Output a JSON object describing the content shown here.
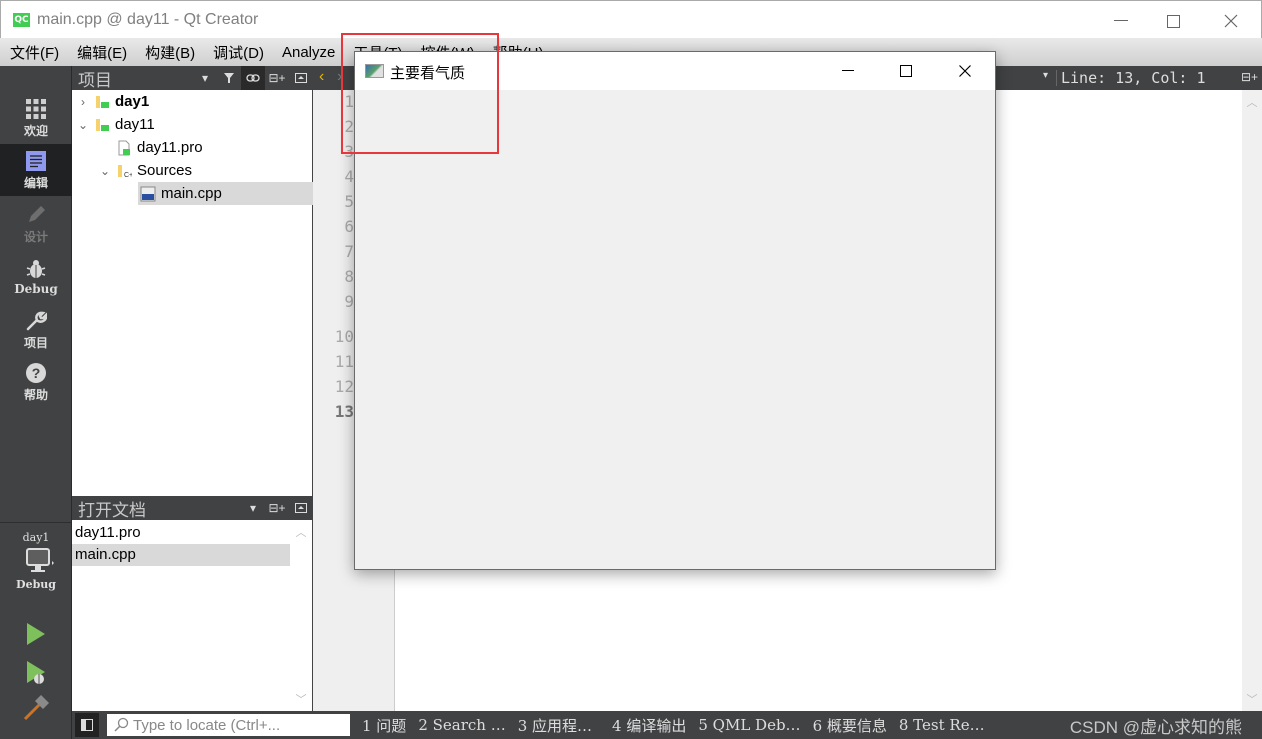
{
  "window": {
    "logo_text": "QC",
    "title": "main.cpp @ day11 - Qt Creator"
  },
  "menubar": {
    "items": [
      "文件(F)",
      "编辑(E)",
      "构建(B)",
      "调试(D)",
      "Analyze",
      "工具(T)",
      "控件(W)",
      "帮助(H)"
    ]
  },
  "modes": [
    {
      "label": "欢迎",
      "icon": "grid-icon",
      "state": "normal"
    },
    {
      "label": "编辑",
      "icon": "edit-document-icon",
      "state": "active"
    },
    {
      "label": "设计",
      "icon": "pencil-icon",
      "state": "disabled"
    },
    {
      "label": "Debug",
      "icon": "bug-icon",
      "state": "normal"
    },
    {
      "label": "项目",
      "icon": "wrench-icon",
      "state": "normal"
    },
    {
      "label": "帮助",
      "icon": "help-icon",
      "state": "normal"
    }
  ],
  "kit": {
    "project": "day1",
    "config": "Debug"
  },
  "projects_pane": {
    "title": "项目",
    "tree": [
      {
        "label": "day1",
        "bold": true,
        "expanded": false,
        "icon": "qt-project-folder-icon"
      },
      {
        "label": "day11",
        "bold": false,
        "expanded": true,
        "icon": "qt-project-folder-icon"
      },
      {
        "label": "day11.pro",
        "icon": "pro-file-icon"
      },
      {
        "label": "Sources",
        "expanded": true,
        "icon": "cpp-folder-icon"
      },
      {
        "label": "main.cpp",
        "selected": true,
        "icon": "cpp-file-icon"
      }
    ]
  },
  "open_docs_pane": {
    "title": "打开文档",
    "docs": [
      {
        "label": "day11.pro",
        "selected": false
      },
      {
        "label": "main.cpp",
        "selected": true
      }
    ]
  },
  "editor": {
    "position": "Line: 13, Col: 1",
    "line_numbers": [
      "1",
      "2",
      "3",
      "4",
      "5",
      "6",
      "7",
      "8",
      "9",
      "10",
      "11",
      "12",
      "13"
    ],
    "current_line": "13"
  },
  "bottombar": {
    "locator_placeholder": "Type to locate (Ctrl+...",
    "tabs": [
      "1 问题",
      "2 Search …",
      "3 应用程…",
      "4 编译输出",
      "5 QML Deb…",
      "6 概要信息",
      "8 Test Re…"
    ],
    "watermark": "CSDN @虚心求知的熊"
  },
  "popup": {
    "title": "主要看气质"
  },
  "colors": {
    "highlight_box": "#e8373b",
    "qt_green": "#41cd52",
    "dark_panel": "#404244"
  }
}
